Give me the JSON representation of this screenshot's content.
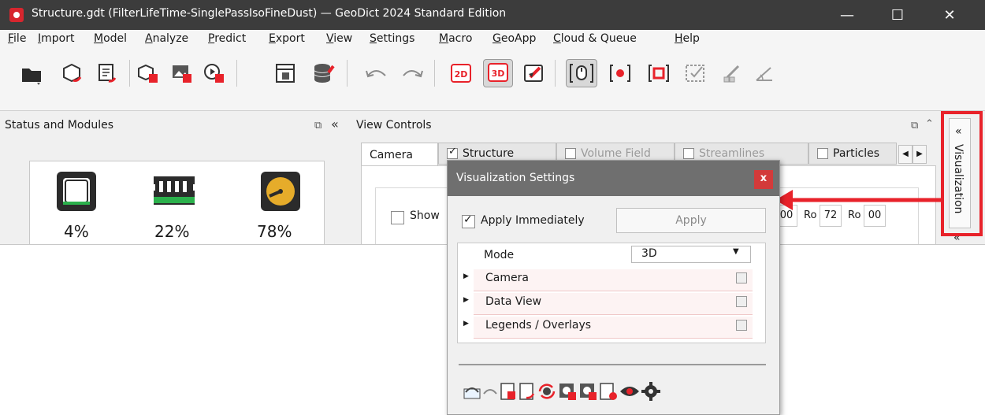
{
  "window": {
    "title": "Structure.gdt (FilterLifeTime-SinglePassIsoFineDust) — GeoDict 2024 Standard Edition",
    "controls": {
      "minimize": "—",
      "maximize": "☐",
      "close": "✕"
    }
  },
  "menu": [
    "File",
    "Import",
    "Model",
    "Analyze",
    "Predict",
    "Export",
    "View",
    "Settings",
    "Macro",
    "GeoApp",
    "Cloud & Queue",
    "Help"
  ],
  "toolbar": {
    "icons": [
      "open-folder",
      "load-structure",
      "results-viewer",
      "model-structure",
      "import-image",
      "play-macro",
      "report-viewer",
      "database",
      "undo",
      "redo",
      "2d-view",
      "3d-view",
      "fly-camera",
      "select-region",
      "select-point",
      "select-box",
      "select-check",
      "measure-brush",
      "measure-angle"
    ],
    "label_2d": "2D",
    "label_3d": "3D"
  },
  "status_panel": {
    "title": "Status and Modules",
    "cpu_percent": "4%",
    "memory_percent": "22%",
    "disk_percent": "78%"
  },
  "view_panel": {
    "title": "View Controls",
    "tabs": [
      {
        "label": "Camera",
        "active": true
      },
      {
        "label": "Structure",
        "checked": true
      },
      {
        "label": "Volume Field",
        "checked": false
      },
      {
        "label": "Streamlines",
        "checked": false
      },
      {
        "label": "Particles",
        "checked": false
      }
    ],
    "show_label": "Show",
    "right_fields": [
      "00",
      "Ro",
      "72",
      "Ro",
      "00"
    ]
  },
  "side_tab": {
    "label": "Visualization",
    "collapse": "«"
  },
  "dialog": {
    "title": "Visualization Settings",
    "close_label": "x",
    "apply_immediately_label": "Apply Immediately",
    "apply_immediately_checked": true,
    "apply_button": "Apply",
    "mode_label": "Mode",
    "mode_value": "3D",
    "sections": [
      "Camera",
      "Data View",
      "Legends / Overlays"
    ]
  },
  "colors": {
    "accent_red": "#e8222a",
    "titlebar": "#3c3c3c",
    "dialog_title": "#6f6f6f"
  }
}
